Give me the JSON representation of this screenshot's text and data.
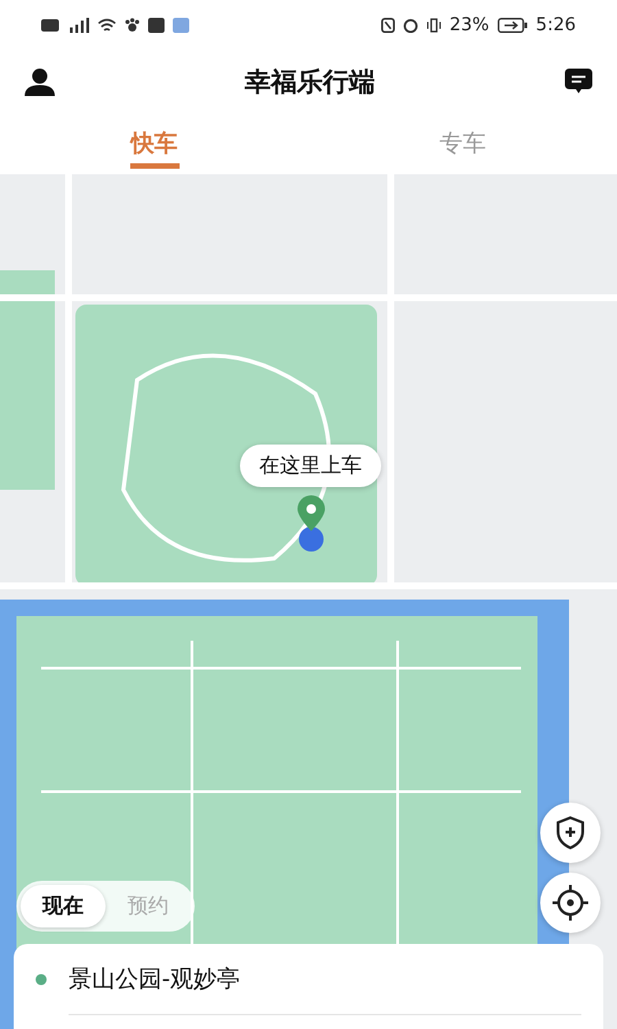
{
  "status_bar": {
    "battery": "23%",
    "time": "5:26"
  },
  "header": {
    "title": "幸福乐行端"
  },
  "tabs": [
    {
      "label": "快车",
      "selected": true
    },
    {
      "label": "专车",
      "selected": false
    }
  ],
  "map": {
    "pickup_label": "在这里上车"
  },
  "mode_toggle": [
    {
      "label": "现在",
      "selected": true
    },
    {
      "label": "预约",
      "selected": false
    }
  ],
  "origin": {
    "text": "景山公园-观妙亭"
  }
}
